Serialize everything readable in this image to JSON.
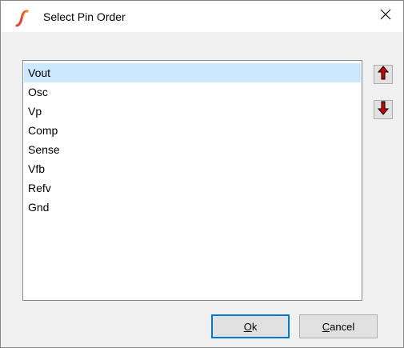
{
  "window": {
    "title": "Select Pin Order",
    "app_icon": "ltspice-icon",
    "close_icon": "close-icon"
  },
  "pin_list": {
    "items": [
      "Vout",
      "Osc",
      "Vp",
      "Comp",
      "Sense",
      "Vfb",
      "Refv",
      "Gnd"
    ],
    "selected": "Vout"
  },
  "side_buttons": {
    "move_up_icon": "arrow-up-icon",
    "move_down_icon": "arrow-down-icon",
    "arrow_color": "#d40000"
  },
  "buttons": {
    "ok_mnemonic": "O",
    "ok_rest": "k",
    "cancel_mnemonic": "C",
    "cancel_rest": "ancel"
  },
  "colors": {
    "selection": "#cce8ff",
    "default_button_border": "#0078d7"
  }
}
